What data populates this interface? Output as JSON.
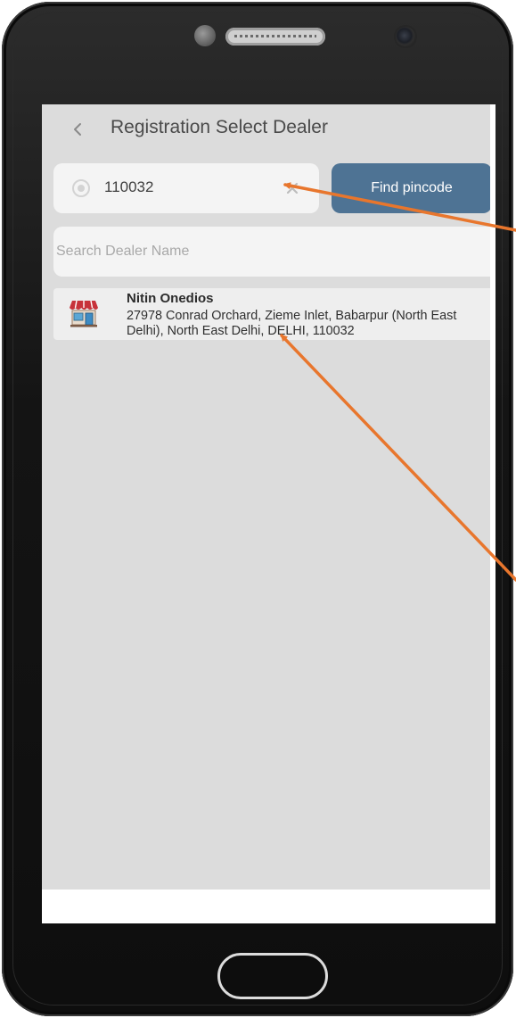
{
  "header": {
    "back_glyph": "<",
    "title": "Registration Select Dealer"
  },
  "pincode": {
    "value": "110032",
    "clear_glyph": "✕"
  },
  "find_button": {
    "label": "Find pincode"
  },
  "dealer_search": {
    "placeholder": "Search Dealer Name"
  },
  "dealers": [
    {
      "name": "Nitin Onedios",
      "address": "27978 Conrad Orchard, Zieme Inlet, Babarpur (North East Delhi), North East Delhi, DELHI, 110032"
    }
  ],
  "icons": {
    "back": "chevron-left-icon",
    "locate": "gps-locate-icon",
    "clear": "close-icon",
    "store": "store-icon"
  },
  "colors": {
    "accent": "#4e7394",
    "app_background": "#dcdcdc",
    "annotation_arrow": "#e8762d"
  }
}
